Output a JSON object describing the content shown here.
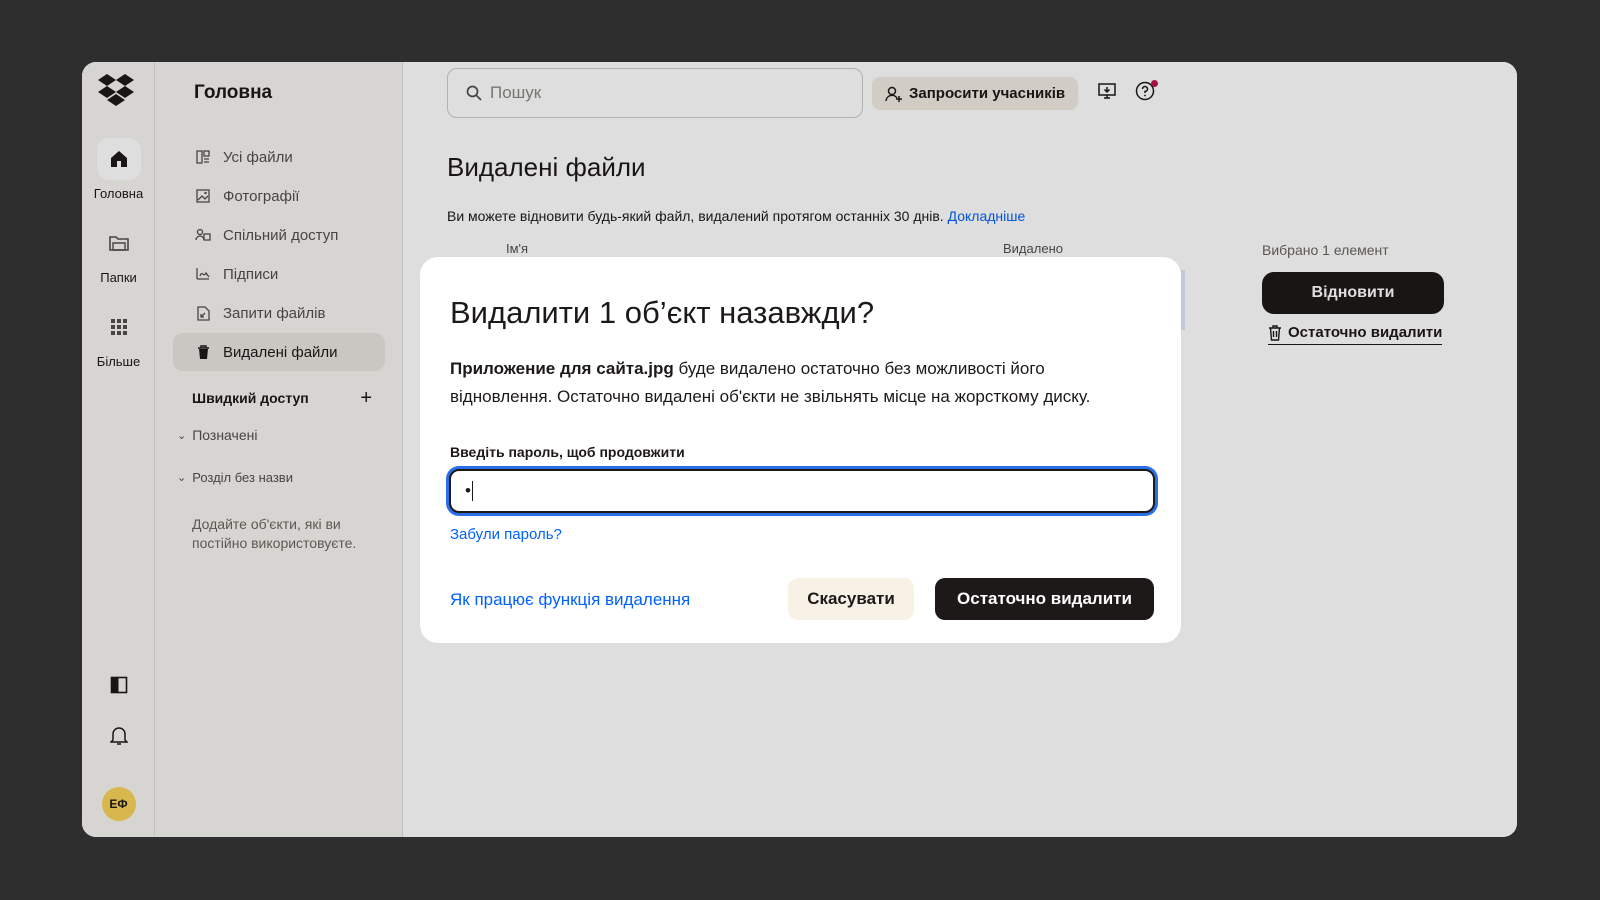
{
  "rail": {
    "items": [
      {
        "label": "Головна",
        "icon": "home-icon"
      },
      {
        "label": "Папки",
        "icon": "folder-icon"
      },
      {
        "label": "Більше",
        "icon": "grid-icon"
      }
    ],
    "avatar_initials": "ЕФ"
  },
  "nav": {
    "title": "Головна",
    "items": [
      {
        "label": "Усі файли",
        "icon": "files-icon"
      },
      {
        "label": "Фотографії",
        "icon": "photos-icon"
      },
      {
        "label": "Спільний доступ",
        "icon": "shared-icon"
      },
      {
        "label": "Підписи",
        "icon": "signature-icon"
      },
      {
        "label": "Запити файлів",
        "icon": "file-request-icon"
      },
      {
        "label": "Видалені файли",
        "icon": "trash-icon",
        "active": true
      }
    ],
    "quick_access": "Швидкий доступ",
    "sections": [
      "Позначені",
      "Розділ без назви"
    ],
    "hint": "Додайте об'єкти, які ви постійно використовуєте."
  },
  "header": {
    "search_placeholder": "Пошук",
    "invite_label": "Запросити учасників"
  },
  "page": {
    "title": "Видалені файли",
    "description": "Ви можете відновити будь-який файл, видалений протягом останніх 30 днів.",
    "learn_more": "Докладніше",
    "columns": {
      "name": "Ім'я",
      "deleted": "Видалено"
    },
    "selected_count": "Вибрано 1 елемент",
    "restore_label": "Відновити",
    "permanent_delete_label": "Остаточно видалити"
  },
  "modal": {
    "title": "Видалити 1 об’єкт назавжди?",
    "file_name": "Приложение для сайта.jpg",
    "body": " буде видалено остаточно без можливості його відновлення. Остаточно видалені об'єкти не звільнять місце на жорсткому диску.",
    "password_label": "Введіть пароль, щоб продовжити",
    "password_value": "•",
    "forgot_link": "Забули пароль?",
    "how_link": "Як працює функція видалення",
    "cancel_label": "Скасувати",
    "delete_label": "Остаточно видалити"
  },
  "colors": {
    "accent_blue": "#0061fe",
    "focus_ring": "#2b6fe8",
    "primary_dark": "#1e1919",
    "avatar_yellow": "#f9d35a",
    "notification_dot": "#c0134f"
  }
}
